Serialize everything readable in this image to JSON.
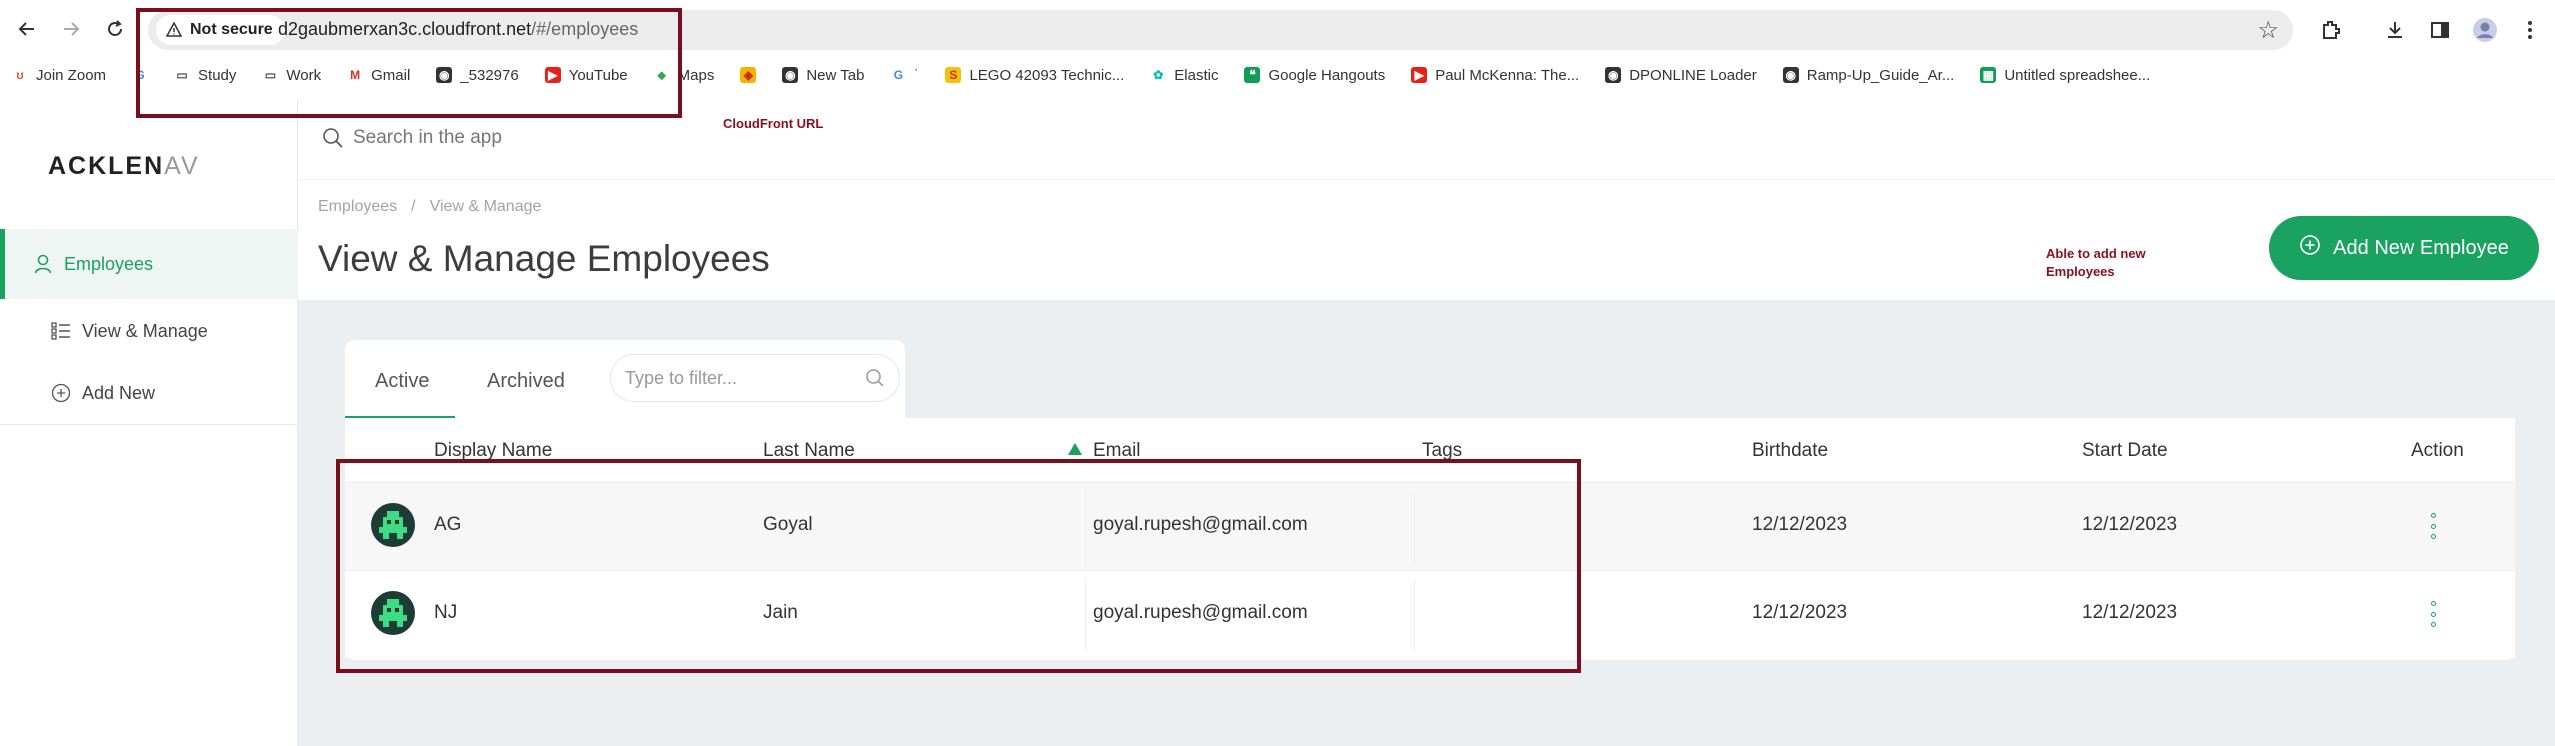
{
  "browser": {
    "security_label": "Not secure",
    "url_host": "d2gaubmerxan3c.cloudfront.net",
    "url_path": "/#/employees"
  },
  "bookmarks": [
    {
      "label": "Join Zoom",
      "icon": "zoom-icon"
    },
    {
      "label": "",
      "icon": "google-icon"
    },
    {
      "label": "Study",
      "icon": "folder-icon"
    },
    {
      "label": "Work",
      "icon": "folder-icon"
    },
    {
      "label": "Gmail",
      "icon": "gmail-icon"
    },
    {
      "label": "_532976",
      "icon": "globe-icon"
    },
    {
      "label": "YouTube",
      "icon": "youtube-icon"
    },
    {
      "label": "Maps",
      "icon": "maps-icon"
    },
    {
      "label": "",
      "icon": "app-icon"
    },
    {
      "label": "New Tab",
      "icon": "globe-icon"
    },
    {
      "label": "˙",
      "icon": "google-icon"
    },
    {
      "label": "LEGO 42093 Technic...",
      "icon": "lego-icon"
    },
    {
      "label": "Elastic",
      "icon": "elastic-icon"
    },
    {
      "label": "Google Hangouts",
      "icon": "hangouts-icon"
    },
    {
      "label": "Paul McKenna: The...",
      "icon": "youtube-icon"
    },
    {
      "label": "DPONLINE Loader",
      "icon": "globe-icon"
    },
    {
      "label": "Ramp-Up_Guide_Ar...",
      "icon": "globe-icon"
    },
    {
      "label": "Untitled spreadshee...",
      "icon": "sheets-icon"
    }
  ],
  "app": {
    "logo_main": "ACKLEN",
    "logo_fade": "AV",
    "search_placeholder": "Search in the app"
  },
  "sidebar": {
    "items": [
      {
        "label": "Employees",
        "icon": "user-icon",
        "active": true
      },
      {
        "label": "View & Manage",
        "icon": "list-icon",
        "active": false
      },
      {
        "label": "Add New",
        "icon": "plus-circle-icon",
        "active": false
      }
    ]
  },
  "header": {
    "breadcrumb_root": "Employees",
    "breadcrumb_sep": "/",
    "breadcrumb_current": "View & Manage",
    "title": "View & Manage Employees",
    "add_button": "Add New Employee"
  },
  "tabs": [
    {
      "label": "Active",
      "active": true
    },
    {
      "label": "Archived",
      "active": false
    }
  ],
  "filter_placeholder": "Type to filter...",
  "table": {
    "columns": [
      "Display Name",
      "Last Name",
      "Email",
      "Tags",
      "Birthdate",
      "Start Date",
      "Action"
    ],
    "rows": [
      {
        "display_name": "AG",
        "last_name": "Goyal",
        "email": "goyal.rupesh@gmail.com",
        "tags": "",
        "birthdate": "12/12/2023",
        "start_date": "12/12/2023"
      },
      {
        "display_name": "NJ",
        "last_name": "Jain",
        "email": "goyal.rupesh@gmail.com",
        "tags": "",
        "birthdate": "12/12/2023",
        "start_date": "12/12/2023"
      }
    ]
  },
  "annotations": {
    "url_note": "CloudFront URL",
    "add_note_line1": "Able to add new",
    "add_note_line2": "Employees"
  },
  "colors": {
    "accent": "#1aa260",
    "annotation": "#7a0f1c",
    "content_bg": "#eceff1"
  }
}
